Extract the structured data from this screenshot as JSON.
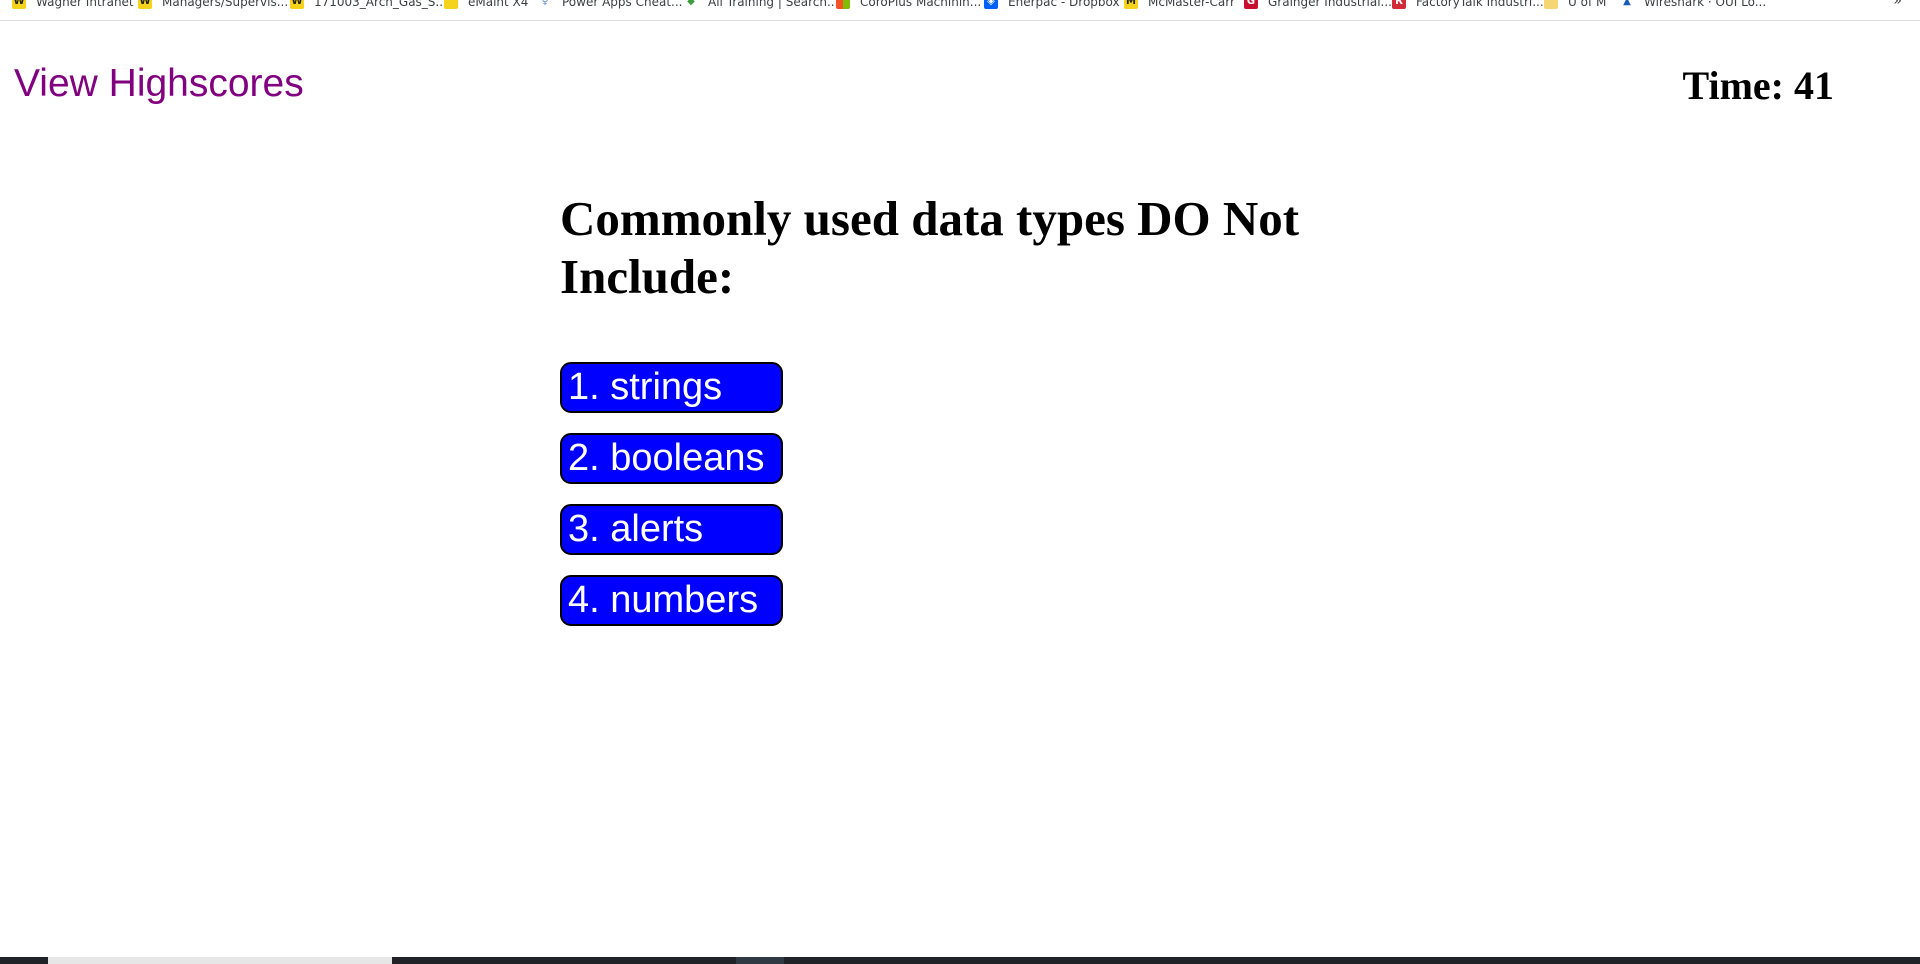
{
  "bookmarks": [
    {
      "label": "Wagner Intranet",
      "icon": "w-logo-icon"
    },
    {
      "label": "Managers/Supervis...",
      "icon": "w-logo-icon"
    },
    {
      "label": "171003_Arch_Gas_S...",
      "icon": "w-logo-icon"
    },
    {
      "label": "eMaint X4",
      "icon": "doc-icon"
    },
    {
      "label": "Power Apps Cheat...",
      "icon": "bulb-icon"
    },
    {
      "label": "All Training | Search...",
      "icon": "stack-icon"
    },
    {
      "label": "CoroPlus Machinin...",
      "icon": "microsoft-icon"
    },
    {
      "label": "Enerpac - Dropbox",
      "icon": "dropbox-icon"
    },
    {
      "label": "McMaster-Carr",
      "icon": "m-logo-icon"
    },
    {
      "label": "Grainger Industrial...",
      "icon": "grainger-icon"
    },
    {
      "label": "FactoryTalk Industri...",
      "icon": "ra-icon"
    },
    {
      "label": "U of M",
      "icon": "folder-icon"
    },
    {
      "label": "Wireshark · OUI Lo...",
      "icon": "wireshark-icon"
    }
  ],
  "bookmarks_more": "»",
  "header": {
    "highscores_link": "View Highscores",
    "timer_label": "Time:",
    "timer_value": "41"
  },
  "quiz": {
    "question": "Commonly used data types DO Not Include:",
    "choices": [
      {
        "label": "1. strings"
      },
      {
        "label": "2. booleans"
      },
      {
        "label": "3. alerts"
      },
      {
        "label": "4. numbers"
      }
    ]
  },
  "colors": {
    "link": "#800080",
    "choice_bg": "#0000ff",
    "choice_text": "#ffffff"
  }
}
